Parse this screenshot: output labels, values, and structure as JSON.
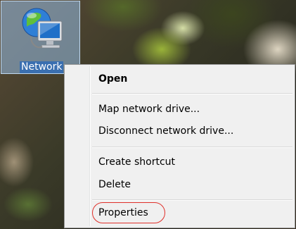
{
  "desktop": {
    "icon": {
      "name": "network-icon",
      "label": "Network"
    }
  },
  "context_menu": {
    "items": [
      {
        "label": "Open",
        "bold": true
      },
      {
        "label": "Map network drive..."
      },
      {
        "label": "Disconnect network drive..."
      },
      {
        "label": "Create shortcut"
      },
      {
        "label": "Delete"
      },
      {
        "label": "Properties",
        "highlighted": true
      }
    ]
  },
  "colors": {
    "menu_background": "#f0f0f0",
    "menu_border": "#979797",
    "highlight_ring": "#e0302a",
    "icon_selection": "#96bee6",
    "label_selection": "#3a6fb0"
  }
}
